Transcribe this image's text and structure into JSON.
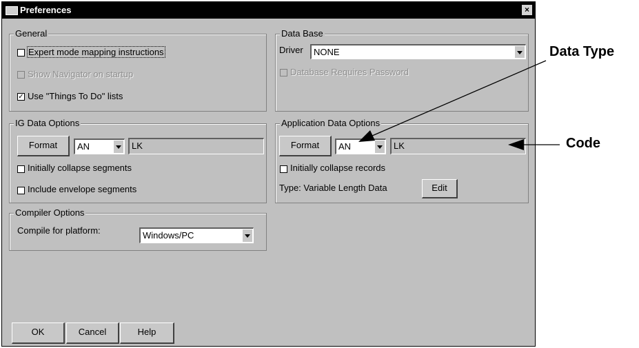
{
  "window": {
    "title": "Preferences",
    "close_label": "×"
  },
  "general": {
    "legend": "General",
    "expert_mode": {
      "label": "Expert mode mapping instructions",
      "checked": false
    },
    "show_navigator": {
      "label": "Show Navigator on startup",
      "checked": false,
      "disabled": true
    },
    "things_to_do": {
      "label": "Use \"Things To Do\" lists",
      "checked": true,
      "mark": "✓"
    }
  },
  "database": {
    "legend": "Data Base",
    "driver_label": "Driver",
    "driver_value": "NONE",
    "requires_password": {
      "label": "Database Requires Password",
      "checked": false,
      "disabled": true
    }
  },
  "ig_data": {
    "legend": "IG Data Options",
    "format_label": "Format",
    "type_value": "AN",
    "code_value": "LK",
    "collapse_segments": "Initially collapse segments",
    "envelope_segments": "Include envelope segments"
  },
  "app_data": {
    "legend": "Application Data Options",
    "format_label": "Format",
    "type_value": "AN",
    "code_value": "LK",
    "collapse_records": "Initially collapse records",
    "type_text": "Type:  Variable Length Data",
    "edit_label": "Edit"
  },
  "compiler": {
    "legend": "Compiler Options",
    "platform_label": "Compile for platform:",
    "platform_value": "Windows/PC"
  },
  "buttons": {
    "ok": "OK",
    "cancel": "Cancel",
    "help": "Help"
  },
  "annotations": {
    "data_type": "Data Type",
    "code": "Code"
  }
}
